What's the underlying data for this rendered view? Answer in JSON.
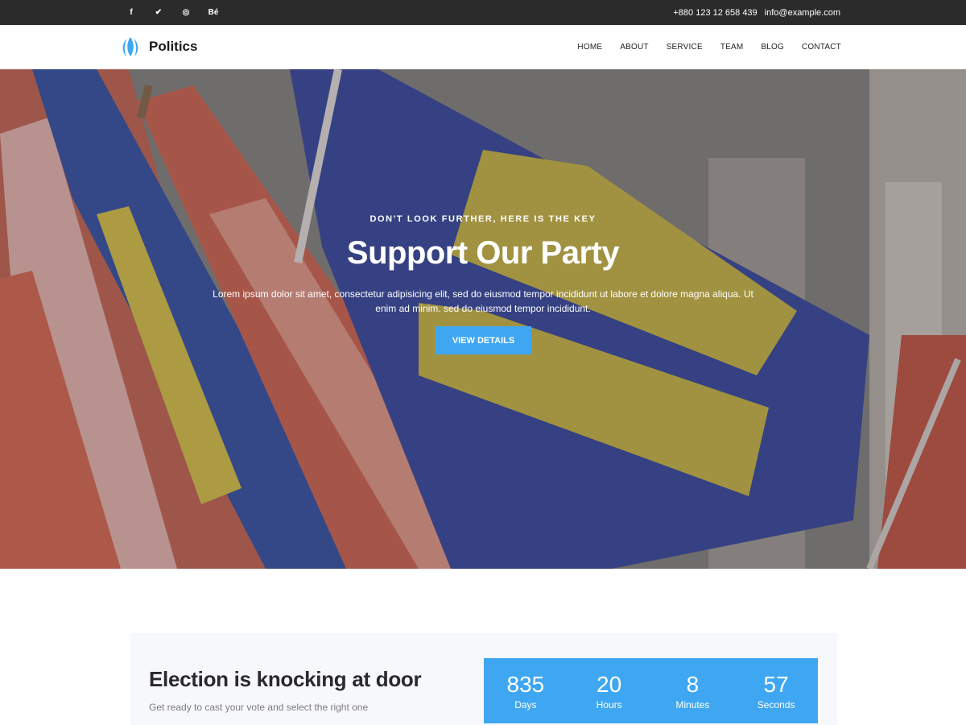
{
  "topbar": {
    "social": [
      {
        "glyph": "f",
        "icon": "facebook-icon"
      },
      {
        "glyph": "✔",
        "icon": "twitter-icon"
      },
      {
        "glyph": "◎",
        "icon": "dribbble-icon"
      },
      {
        "glyph": "Bé",
        "icon": "behance-icon"
      }
    ],
    "phone": "+880 123 12 658 439",
    "email": "info@example.com"
  },
  "header": {
    "brand": "Politics",
    "nav": [
      "HOME",
      "ABOUT",
      "SERVICE",
      "TEAM",
      "BLOG",
      "CONTACT"
    ]
  },
  "hero": {
    "subtitle": "DON'T LOOK FURTHER, HERE IS THE KEY",
    "title": "Support Our Party",
    "description": "Lorem ipsum dolor sit amet, consectetur adipisicing elit, sed do eiusmod tempor incididunt ut labore et dolore magna aliqua. Ut enim ad minim. sed do eiusmod tempor incididunt.",
    "button_label": "VIEW DETAILS"
  },
  "election": {
    "title": "Election is knocking at door",
    "subtitle": "Get ready to cast your vote and select the right one",
    "countdown": [
      {
        "value": "835",
        "label": "Days"
      },
      {
        "value": "20",
        "label": "Hours"
      },
      {
        "value": "8",
        "label": "Minutes"
      },
      {
        "value": "57",
        "label": "Seconds"
      }
    ]
  },
  "colors": {
    "accent": "#3fa7f1",
    "topbar": "#2b2b2b"
  }
}
